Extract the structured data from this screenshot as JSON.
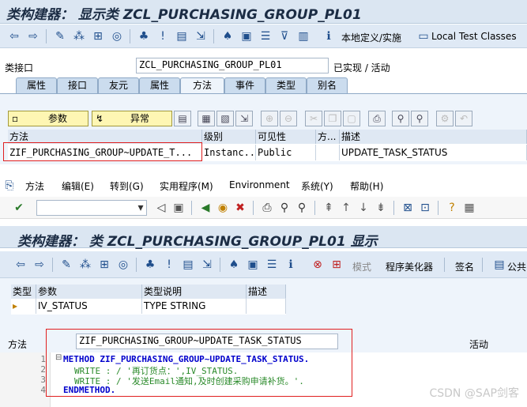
{
  "top_window": {
    "title": "类构建器： 显示类 ZCL_PURCHASING_GROUP_PL01",
    "toolbar_right": [
      "本地定义/实施",
      "Local Test Classes"
    ],
    "class_label": "类接口",
    "class_value": "ZCL_PURCHASING_GROUP_PL01",
    "class_status": "已实现 / 活动",
    "tabs": [
      "属性",
      "接口",
      "友元",
      "属性",
      "方法",
      "事件",
      "类型",
      "别名"
    ],
    "active_tab": "方法",
    "btn_params": "参数",
    "btn_exceptions": "异常",
    "grid_headers": [
      "方法",
      "级别",
      "可见性",
      "方...",
      "描述"
    ],
    "grid_row": [
      "ZIF_PURCHASING_GROUP~UPDATE_T...",
      "Instanc...",
      "Public",
      "",
      "UPDATE_TASK_STATUS"
    ]
  },
  "bottom_window": {
    "menu": [
      "方法",
      "编辑(E)",
      "转到(G)",
      "实用程序(M)",
      "Environment",
      "系统(Y)",
      "帮助(H)"
    ],
    "title": "类构建器： 类 ZCL_PURCHASING_GROUP_PL01 显示",
    "toolbar_text": [
      "模式",
      "程序美化器",
      "签名",
      "公共"
    ],
    "param_headers": [
      "类型",
      "参数",
      "类型说明",
      "描述"
    ],
    "param_row": [
      "",
      "IV_STATUS",
      "TYPE STRING",
      ""
    ],
    "method_label": "方法",
    "method_value": "ZIF_PURCHASING_GROUP~UPDATE_TASK_STATUS",
    "method_status": "活动",
    "code_lines": [
      {
        "n": "1",
        "text": "METHOD ZIF_PURCHASING_GROUP~UPDATE_TASK_STATUS."
      },
      {
        "n": "2",
        "text": "WRITE : / '再订货点：',IV_STATUS."
      },
      {
        "n": "3",
        "text": "WRITE : / '发送Email通知,及时创建采购申请补货。'."
      },
      {
        "n": "4",
        "text": "ENDMETHOD."
      }
    ]
  },
  "watermark": "CSDN @SAP剑客"
}
